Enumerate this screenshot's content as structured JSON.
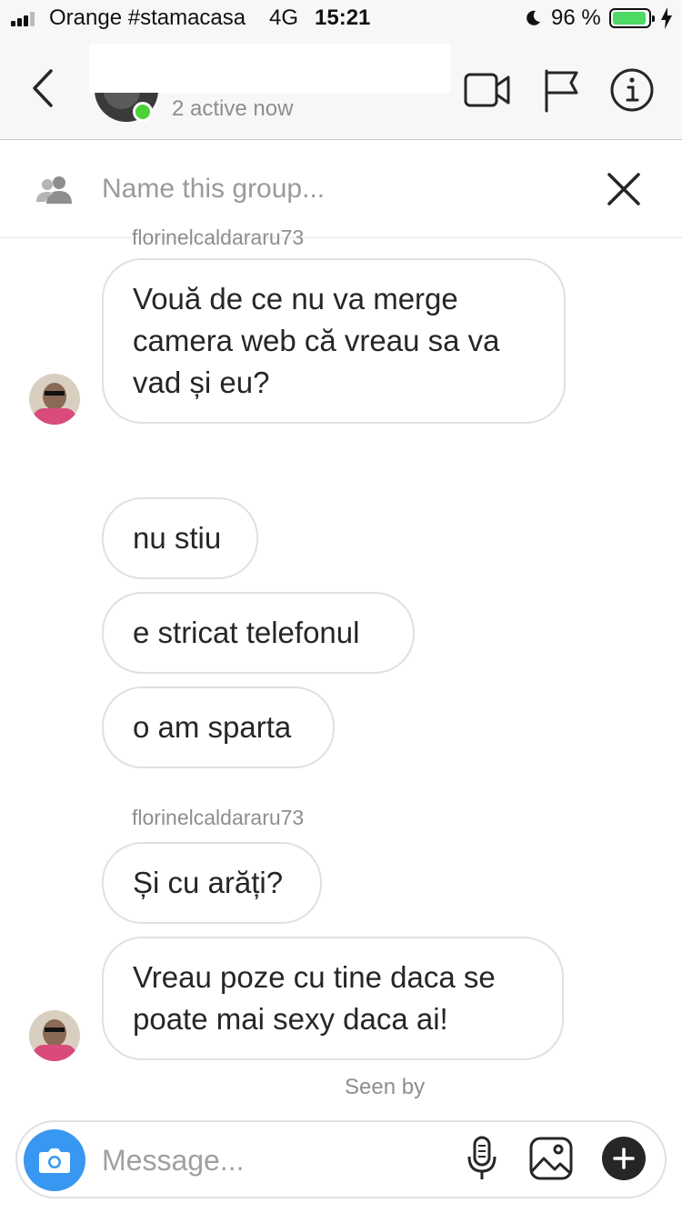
{
  "status_bar": {
    "carrier": "Orange #stamacasa",
    "network": "4G",
    "time": "15:21",
    "battery_percent": "96 %",
    "battery_level": 0.96,
    "battery_color": "#4cd964"
  },
  "header": {
    "active_status": "2 active now",
    "icons": [
      "back-chevron-icon",
      "video-camera-icon",
      "flag-icon",
      "info-icon"
    ]
  },
  "group_bar": {
    "placeholder": "Name this group...",
    "icons": [
      "people-icon",
      "close-icon"
    ]
  },
  "messages": [
    {
      "sender": "florinelcaldararu73",
      "text": "Vouă de ce nu va merge\ncamera web că vreau sa va\nvad și eu?",
      "has_avatar": true
    },
    {
      "sender": "",
      "text": "nu stiu",
      "has_avatar": false
    },
    {
      "sender": "",
      "text": "e stricat telefonul",
      "has_avatar": false
    },
    {
      "sender": "",
      "text": "o am sparta",
      "has_avatar": false
    },
    {
      "sender": "florinelcaldararu73",
      "text": "Și cu arăți?",
      "has_avatar": false
    },
    {
      "sender": "",
      "text": "Vreau poze cu tine daca se\npoate mai sexy daca ai!",
      "has_avatar": true
    }
  ],
  "seen_label": "Seen by",
  "composer": {
    "placeholder": "Message...",
    "icons": [
      "camera-icon",
      "microphone-icon",
      "gallery-icon",
      "plus-icon"
    ],
    "accent_color": "#3897f0"
  }
}
